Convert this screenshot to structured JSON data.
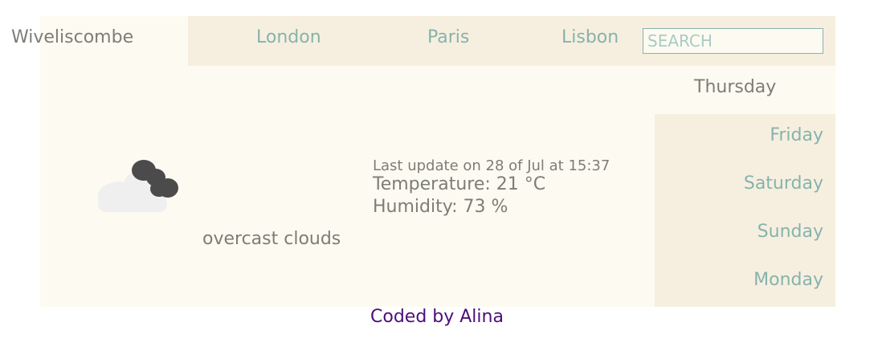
{
  "header": {
    "current_city": "Wiveliscombe",
    "links": [
      "London",
      "Paris",
      "Lisbon"
    ],
    "search_placeholder": "SEARCH"
  },
  "weather": {
    "icon": "overcast-clouds-icon",
    "description": "overcast clouds",
    "last_update": "Last update on 28 of Jul at 15:37",
    "temperature": "Temperature: 21 °C",
    "humidity": "Humidity: 73 %"
  },
  "days": {
    "today": "Thursday",
    "forecast": [
      "Friday",
      "Saturday",
      "Sunday",
      "Monday"
    ]
  },
  "footer": {
    "credit": "Coded by Alina"
  },
  "colors": {
    "panel": "#fdfbf1",
    "nav": "#f6efdf",
    "accent": "#86b3ad",
    "text": "#7d7d78",
    "footer": "#4b0f78"
  }
}
